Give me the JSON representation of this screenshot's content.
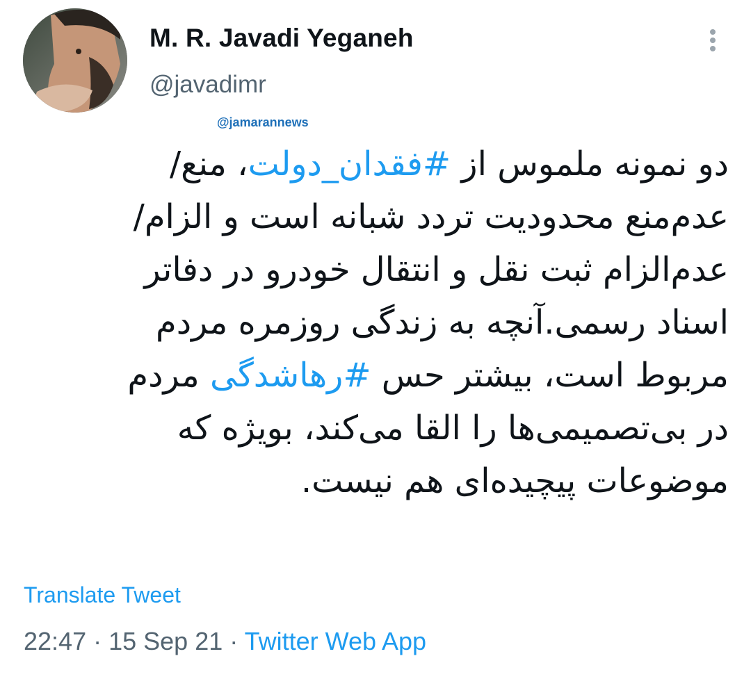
{
  "author": {
    "display_name": "M. R. Javadi Yeganeh",
    "handle": "@javadimr",
    "avatar_icon": "avatar-photo"
  },
  "watermark": "@jamarannews",
  "tweet": {
    "lines": [
      [
        {
          "t": "دو نمونه ملموس از "
        },
        {
          "t": "#فقدان_دولت",
          "tag": true
        },
        {
          "t": "، منع/"
        }
      ],
      [
        {
          "t": "عدم‌منع محدودیت تردد شبانه است و الزام/"
        }
      ],
      [
        {
          "t": "عدم‌الزام ثبت نقل و انتقال خودرو در دفاتر"
        }
      ],
      [
        {
          "t": "اسناد رسمی.آنچه به زندگی روزمره مردم"
        }
      ],
      [
        {
          "t": "مربوط است، بیشتر حس "
        },
        {
          "t": "#رهاشدگی",
          "tag": true
        },
        {
          "t": " مردم"
        }
      ],
      [
        {
          "t": "در بی‌تصمیمی‌ها را القا می‌کند، بویژه که"
        }
      ],
      [
        {
          "t": "موضوعات پیچیده‌ای هم نیست."
        }
      ]
    ]
  },
  "translate_label": "Translate Tweet",
  "meta": {
    "time": "22:47",
    "separator": " · ",
    "date": "15 Sep 21",
    "source": "Twitter Web App"
  },
  "colors": {
    "link": "#1d9bf0",
    "secondary": "#536471",
    "text": "#0f1419",
    "watermark": "#1d6fb8"
  }
}
